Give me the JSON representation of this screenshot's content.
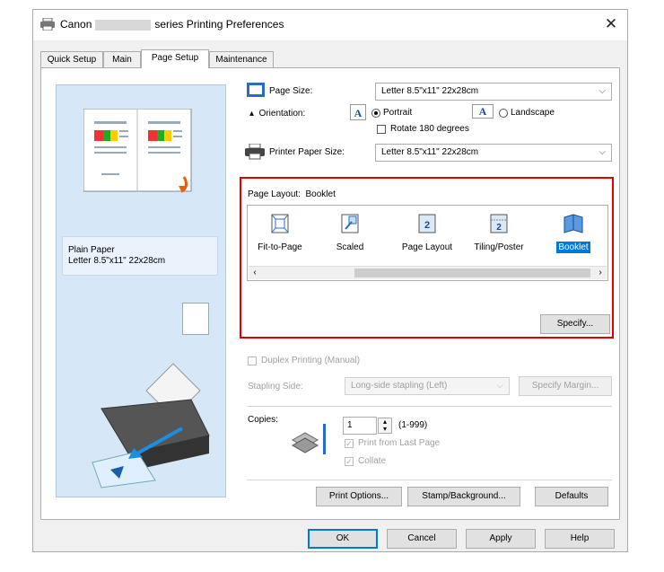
{
  "window": {
    "title_prefix": "Canon",
    "title_suffix": "series Printing Preferences"
  },
  "tabs": [
    {
      "label": "Quick Setup"
    },
    {
      "label": "Main"
    },
    {
      "label": "Page Setup"
    },
    {
      "label": "Maintenance"
    }
  ],
  "preview": {
    "paper_type": "Plain Paper",
    "paper_size": "Letter 8.5\"x11\" 22x28cm"
  },
  "page_size": {
    "label": "Page Size:",
    "value": "Letter 8.5\"x11\" 22x28cm"
  },
  "orientation": {
    "label": "Orientation:",
    "portrait": "Portrait",
    "landscape": "Landscape",
    "rotate": "Rotate 180 degrees"
  },
  "printer_paper_size": {
    "label": "Printer Paper Size:",
    "value": "Letter 8.5\"x11\" 22x28cm"
  },
  "page_layout": {
    "label": "Page Layout:",
    "current": "Booklet",
    "items": [
      {
        "label": "Fit-to-Page"
      },
      {
        "label": "Scaled"
      },
      {
        "label": "Page Layout"
      },
      {
        "label": "Tiling/Poster"
      },
      {
        "label": "Booklet"
      }
    ],
    "specify": "Specify..."
  },
  "duplex": {
    "label": "Duplex Printing (Manual)"
  },
  "stapling": {
    "label": "Stapling Side:",
    "value": "Long-side stapling (Left)",
    "margin_button": "Specify Margin..."
  },
  "copies": {
    "label": "Copies:",
    "value": "1",
    "range": "(1-999)",
    "last_page": "Print from Last Page",
    "collate": "Collate"
  },
  "bottom_buttons": {
    "print_options": "Print Options...",
    "stamp": "Stamp/Background...",
    "defaults": "Defaults"
  },
  "dialog_buttons": {
    "ok": "OK",
    "cancel": "Cancel",
    "apply": "Apply",
    "help": "Help"
  },
  "colors": {
    "highlight": "#0078d7",
    "callout": "#e00000",
    "preview_bg": "#d6e7f7"
  }
}
